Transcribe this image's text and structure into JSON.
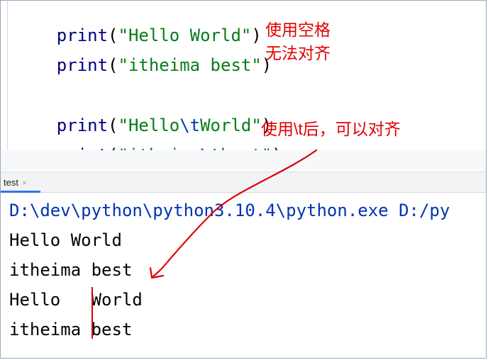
{
  "editor": {
    "lines": [
      {
        "fn": "print",
        "open": "(",
        "str_a": "\"Hello World\"",
        "esc": "",
        "str_b": "",
        "close": ")"
      },
      {
        "fn": "print",
        "open": "(",
        "str_a": "\"itheima best\"",
        "esc": "",
        "str_b": "",
        "close": ")"
      },
      {
        "fn": "print",
        "open": "(",
        "str_a": "\"Hello",
        "esc": "\\t",
        "str_b": "World\"",
        "close": ")"
      },
      {
        "fn": "print",
        "open": "(",
        "str_a": "\"itheima",
        "esc": "\\t",
        "str_b": "best\"",
        "close": ")"
      }
    ]
  },
  "run_panel": {
    "tab_label": "test",
    "tab_close": "×"
  },
  "console": {
    "lines": [
      "D:\\dev\\python\\python3.10.4\\python.exe D:/py",
      "Hello World",
      "itheima best",
      "Hello   World",
      "itheima best"
    ]
  },
  "annotations": {
    "spaces_line1": "使用空格",
    "spaces_line2": "无法对齐",
    "tab_note": "使用\\t后，可以对齐"
  },
  "colors": {
    "annotation": "#e00000",
    "string": "#067d17",
    "escape": "#0037a6",
    "function": "#000080",
    "tab_underline": "#3574f0"
  }
}
